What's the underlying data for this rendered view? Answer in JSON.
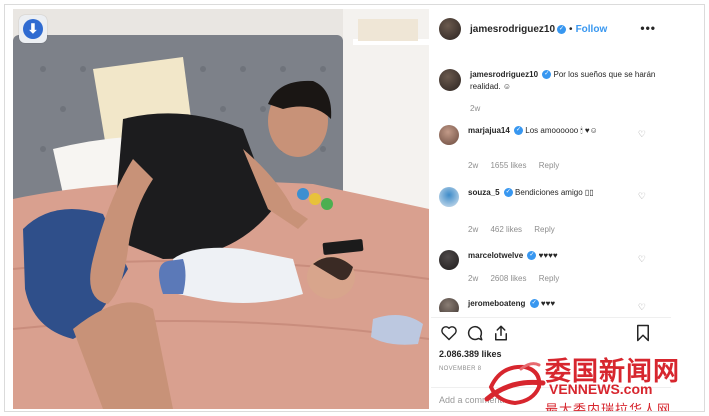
{
  "post": {
    "username": "jamesrodriguez10",
    "follow_label": "Follow",
    "more_label": "•••",
    "separator": "•"
  },
  "caption": {
    "username": "jamesrodriguez10",
    "text": "Por los sueños que se harán realidad. ☺",
    "time": "2w"
  },
  "comments": [
    {
      "username": "marjajua14",
      "text": "Los amoooooo 🕯 ♥☺",
      "time": "2w",
      "likes": "1655 likes",
      "reply": "Reply"
    },
    {
      "username": "souza_5",
      "text": "Bendiciones amigo ▯▯",
      "time": "2w",
      "likes": "462 likes",
      "reply": "Reply"
    },
    {
      "username": "marcelotwelve",
      "text": "♥♥♥♥",
      "time": "2w",
      "likes": "2608 likes",
      "reply": "Reply"
    },
    {
      "username": "jeromeboateng",
      "text": "♥♥♥",
      "time": "",
      "likes": "",
      "reply": ""
    }
  ],
  "actions": {
    "likes_count": "2.086.389 likes",
    "date": "NOVEMBER 8",
    "comment_placeholder": "Add a comment..."
  },
  "icons": {
    "heart": "heart-icon",
    "comment": "comment-icon",
    "share": "share-icon",
    "bookmark": "bookmark-icon",
    "zoom": "zoom-icon"
  },
  "watermark": {
    "chinese": "委国新闻网",
    "english": "VENNEWS.com",
    "subtitle": "最大委内瑞拉华人网"
  },
  "colors": {
    "accent": "#3897f0",
    "watermark": "#d7262e",
    "muted": "#8e8e8e"
  }
}
